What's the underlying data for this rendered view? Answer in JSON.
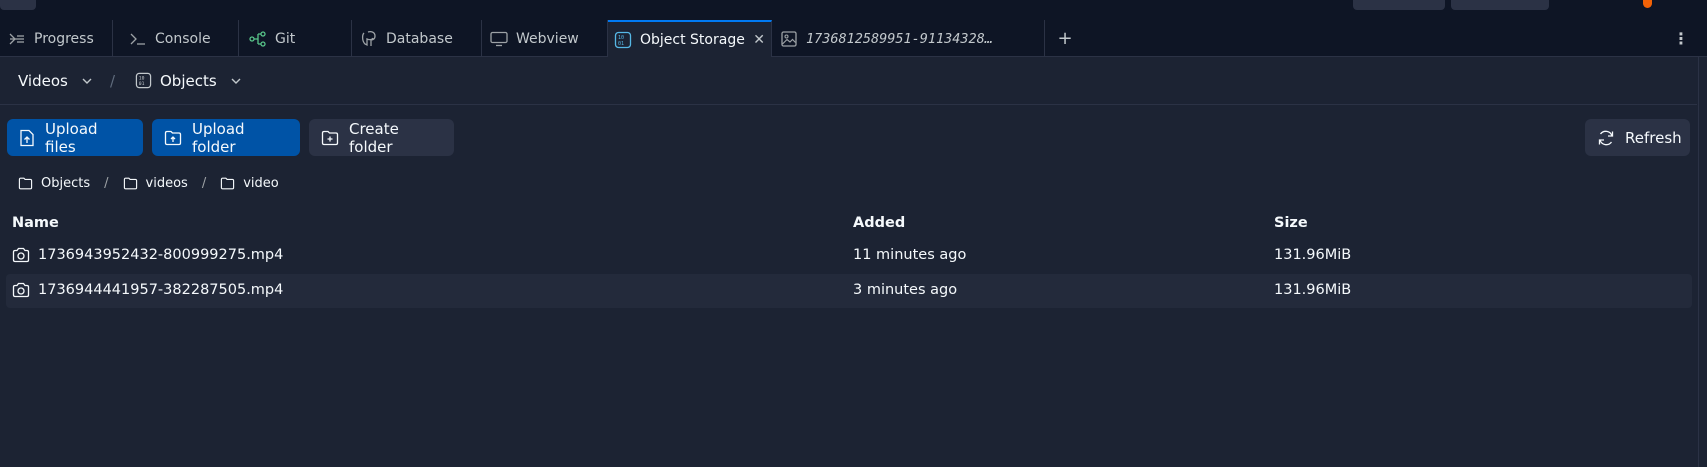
{
  "tabs": [
    {
      "label": "Progress",
      "icon": "progress-icon"
    },
    {
      "label": "Console",
      "icon": "console-icon"
    },
    {
      "label": "Git",
      "icon": "git-icon"
    },
    {
      "label": "Database",
      "icon": "database-icon"
    },
    {
      "label": "Webview",
      "icon": "monitor-icon"
    },
    {
      "label": "Object Storage",
      "icon": "object-storage-icon",
      "active": true
    },
    {
      "label": "1736812589951-91134328…",
      "icon": "image-icon"
    }
  ],
  "header": {
    "bucket": "Videos",
    "section": "Objects"
  },
  "toolbar": {
    "upload_files": "Upload files",
    "upload_folder": "Upload folder",
    "create_folder": "Create folder",
    "refresh": "Refresh"
  },
  "path": [
    "Objects",
    "videos",
    "video"
  ],
  "table": {
    "columns": {
      "name": "Name",
      "added": "Added",
      "size": "Size"
    },
    "rows": [
      {
        "name": "1736943952432-800999275.mp4",
        "added": "11 minutes ago",
        "size": "131.96MiB"
      },
      {
        "name": "1736944441957-382287505.mp4",
        "added": "3 minutes ago",
        "size": "131.96MiB"
      }
    ]
  },
  "colors": {
    "background": "#1c2333",
    "tabbar": "#0e1525",
    "primary_button": "#0053a6",
    "secondary_button": "#2b3245",
    "active_tab_accent": "#0079f2",
    "git_icon": "#58c58a"
  }
}
